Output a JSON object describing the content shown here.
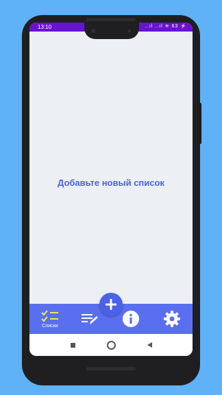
{
  "status": {
    "time": "13:10",
    "icons": "..ıl ..ıl ≋ 63 ⚡"
  },
  "main": {
    "empty_message": "Добавьте новый список"
  },
  "bottom_nav": {
    "items": [
      {
        "label": "Списки",
        "icon": "checklist-icon"
      },
      {
        "label": "",
        "icon": "edit-list-icon"
      },
      {
        "label": "",
        "icon": "info-icon"
      },
      {
        "label": "",
        "icon": "gear-icon"
      }
    ],
    "fab_icon": "plus-icon"
  },
  "colors": {
    "status_bar": "#6a12d4",
    "accent": "#5a6ff0",
    "message": "#4d63d9",
    "background": "#5fb2f7"
  }
}
